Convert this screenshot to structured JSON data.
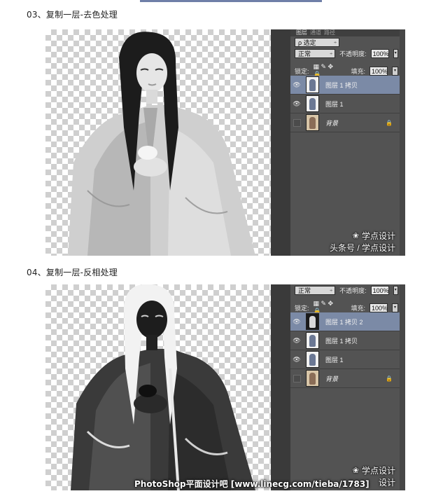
{
  "sections": [
    {
      "title": "03、复制一层-去色处理",
      "panel": {
        "tabs": [
          "图层",
          "通道",
          "路径"
        ],
        "close": "×",
        "filter_label": "ρ 选定",
        "blend_mode": "正常",
        "opacity_label": "不透明度:",
        "opacity_value": "100%",
        "lock_label": "锁定:",
        "lock_icons": "▦ ✎ ✥ 🔒",
        "fill_label": "填充:",
        "fill_value": "100%",
        "layers": [
          {
            "name": "图层 1 拷贝",
            "selected": true
          },
          {
            "name": "图层 1",
            "selected": false
          },
          {
            "name": "背景",
            "selected": false
          }
        ]
      },
      "watermark": {
        "brand": "学点设计",
        "source": "头条号 / 学点设计"
      }
    },
    {
      "title": "04、复制一层-反相处理",
      "panel": {
        "blend_mode": "正常",
        "opacity_label": "不透明度:",
        "opacity_value": "100%",
        "lock_label": "锁定:",
        "lock_icons": "▦ ✎ ✥ 🔒",
        "fill_label": "填充:",
        "fill_value": "100%",
        "layers": [
          {
            "name": "图层 1 拷贝 2",
            "selected": true
          },
          {
            "name": "图层 1 拷贝",
            "selected": false
          },
          {
            "name": "图层 1",
            "selected": false
          },
          {
            "name": "背景",
            "selected": false
          }
        ]
      },
      "watermark": {
        "brand": "学点设计",
        "source": "设计"
      }
    }
  ],
  "footer_banner": "PhotoShop平面设计吧 [www.linecg.com/tieba/1783]",
  "colors": {
    "panel": "#535353",
    "selected_layer": "#7b8aa6",
    "checker": "#cfcfcf"
  }
}
